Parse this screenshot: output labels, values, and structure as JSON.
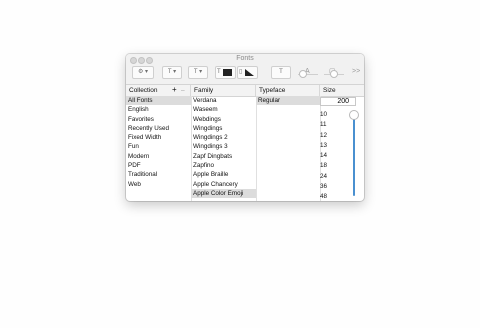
{
  "window": {
    "title": "Fonts"
  },
  "toolbar": {
    "action_menu": "⚙ ▾",
    "underline_menu": "T ▾",
    "strike_menu": "T ▾",
    "text_color": "T",
    "doc_color": "",
    "shadow": "T",
    "more": ">>"
  },
  "headers": {
    "collection": "Collection",
    "family": "Family",
    "typeface": "Typeface",
    "size": "Size",
    "add": "+",
    "remove": "–"
  },
  "collections": [
    "All Fonts",
    "English",
    "Favorites",
    "Recently Used",
    "Fixed Width",
    "Fun",
    "Modern",
    "PDF",
    "Traditional",
    "Web"
  ],
  "families": [
    "Verdana",
    "Waseem",
    "Webdings",
    "Wingdings",
    "Wingdings 2",
    "Wingdings 3",
    "Zapf Dingbats",
    "Zapfino",
    "Apple Braille",
    "Apple Chancery",
    "Apple Color Emoji"
  ],
  "typefaces": [
    "Regular"
  ],
  "size": {
    "value": "200",
    "options": [
      "10",
      "11",
      "12",
      "13",
      "14",
      "18",
      "24",
      "36",
      "48"
    ]
  },
  "selection": {
    "collection": "All Fonts",
    "family": "Apple Color Emoji",
    "typeface": "Regular"
  }
}
